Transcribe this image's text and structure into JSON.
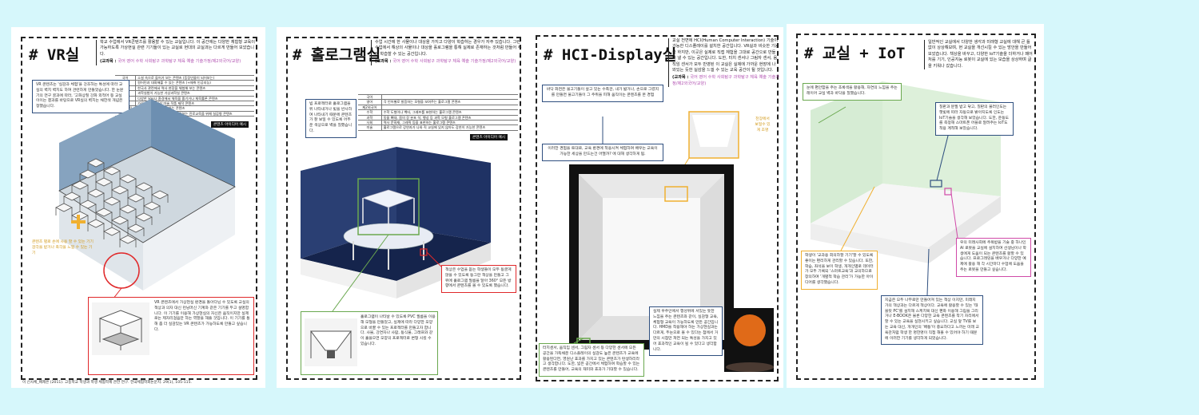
{
  "panels": {
    "vr": {
      "title": "# VR실",
      "intro": "학교 수업에서 VR콘텐츠를 활용할 수 있는 교실입니다. 이 공간에는 다양한 체험형 교육이 가능하도록 가상현실 관련 기기들이 있는 교실로 현대의 교실과는 다르게 만들어 보았습니다.",
      "subjects_label": "(교과목 :",
      "subjects_tags": "국어 영어 수학 사회탐구 과학탐구 체육 예술 기술가정/제2외국어/교양)",
      "table": [
        [
          "국어",
          "소설 속으로 들어가 보는 콘텐츠 (등장인물이 되어보는)"
        ],
        [
          "영어",
          "원어민과 대화해볼 수 있는 콘텐츠 (+매취 인공지능)"
        ],
        [
          "사회",
          "한국사 관련에서 역사 현장을 체험해 보는 콘텐츠"
        ],
        [
          "과학",
          "과학실험이 가능한 가상과학실 콘텐츠"
        ],
        [
          "체육",
          "다양한 날씨나 환경에서 체육을 즐기거나 체육률론 콘텐츠"
        ],
        [
          "예술",
          "가상 미술관, 가상 미술 작품 제작 콘텐츠"
        ],
        [
          "기술·가정",
          "요리 실습을 가상으로 하는 콘텐츠"
        ],
        [
          "진로·진로",
          "다양한 콘텐츠, 학교에서 어려워하는 진로교육을 위해 실감형 콘텐츠"
        ]
      ],
      "ex_button": "콘텐츠 아이디어 예시",
      "note_blue": "VR 콘텐츠는 '실감과 체험'을 강조하는 특성에 따라 교실의 벽치 벽치도 하여 관련하게 만들었습니다. 한 눈문기의 면구 골과에 따라, '고화상질 강화 외적어 등 교실이이는 결과를 바탕으로 VR실의 벽치는 채한색 개념은 정했습니다.",
      "note_orange": "콘텐츠 별로 손에 사용 할 수 있는 기기 감각을 받거나 촉각을 느낄 수 있는 기기",
      "note_red": "VR 콘텐츠에서 가상현실 환경을 돌아다님 수 있도록 교실의 책상과 의자 대신 런닝머신 기계와 같은 기기를 두고 설명합니다. 이 기기를 이용해 가상현실의 자신은 움직이지만 실제로는 제자리걸음만 하는 역할을 해줄 것입니다. 이 기기를 통해 좀 더 실감있는 VR 콘텐츠가 가능하도록 만들고 싶습니다.",
      "footer": "이 신사체_배제은 (2011). 고등학교 학생과 학생 체험학제 관한 연구. 한국체험학회논문지. 29(1), 105-115."
    },
    "holo": {
      "title": "# 홀로그램실",
      "intro": "수업 시간에 한 사물이나 대상을 가지고 다양이 학습하는 경우가 자주 있습니다. 그런 수업에서 해상의 사물이나 대상을 홀로그램을 통해 실제로 존재하는 것처럼 만들어 주어 학습할 수 있는 공간입니다.",
      "subjects_label": "(교과목 :",
      "subjects_tags": "국어 영어 수학 사회탐구 과학탐구 체육 예술 기술가정/제2외국어/교양)",
      "table": [
        [
          "국어",
          ""
        ],
        [
          "영어",
          "각 언어별로 발음하는 모형을 보여주는 홀로그램 콘텐츠"
        ],
        [
          "제2외국어",
          ""
        ],
        [
          "수학",
          "수학 도형이나 벡터, 그래프를 표현하는 홀로그램 콘텐츠"
        ],
        [
          "과학",
          "동물 뼈대, 몸의 장 분포 석, 행성 등 과학 모형 홀로그램 콘텐츠"
        ],
        [
          "사회",
          "역사 문화재, 그레픽 등을 표현하는 홀로그램 콘텐츠"
        ],
        [
          "미술",
          "홀로그램으로 강연자가 나와 직 교실에 있지 않아도 강연이 가능한 콘텐츠"
        ]
      ],
      "ex_button": "콘텐츠 아이디어 예시",
      "note_blue": "빔 프로젝터로 홀로그램을 위 나타내거나 빛을 반사하여 나타내기 때문에 콘텐츠가 잘 보일 수 있도록 어두운 색상으로 벽을 칠했습니다.",
      "note_red": "책상은 수업을 듣는 학생들이 모두 동글게 앉을 수 있도록 동그란 책상을 만들고 그 위에 홀로그램 필름을 달아 360° 모든 방향에서 콘텐츠를 볼 수 있도록 했습니다.",
      "note_green": "홀로그램이 나타날 수 있도록 PVC 필름을 이용해 모형을 만들었고, 실제에 따라 다양한 모양으로 바꿀 수 있는 프로젝터를 만들고자 합니다. 사물, 강연자나 사람, 동식물, 그래프와 같이 홀을으면 모양의 프로젝터로 변형 시킬 수 있습니다."
    },
    "hci": {
      "title": "# HCI-Display실",
      "intro": "교실 전면에 HCI(Human Computer Interaction) 기술이 가능한 디스플레이를 설치한 공간입니다. VR실과 비슷한 기능을 하지만, 이곳은 실제로 직접 체험을 그대로 공간으로 만들어 낼 수 있는 공간입니다. 도한, 터치 센서나 그림자 센서, 움직임 센서가 모두 반영된 이 교실은 실제에 가까운 현장에 나와있는 듯한 실감을 느낄 수 있는 교육 공간이 될 것입니다.",
      "subjects_label": "(교과목 :",
      "subjects_tags": "국어 영어 수학 사회탐구 과학탐구 체육 예술 기술가정/제2외국어/교양)",
      "note_blue1": "바닥 화면은 물고기들이 살고 있는 수족관, 내가 밟거나, 손으로 그렸지를 만들면 물고기들이 그 주위을 피해 움직이는 콘텐츠를 본 경험",
      "note_blue2": "이러한 경험을 토대로, 교육 환경에 적용시켜 체험하며 배우는 교육이 가능한 세상을 만드는건 어떨까? 에 대해 생각하게 됨.",
      "note_orange": "천장에서 보일수 있게 조명",
      "note_green": "터치센서, 움직임 센서, 그림자 센서 등 다양한 센서에 모든 공간을 가득채운 디스플레이의 실감도 높은 콘텐츠가 교육에 활용된다면, 영원난 효과를 가지고 있는 콘텐츠가 탄생하리라고 생각합니다. 도한, 넓은 공간에서 체험하며 학습할 수 있는 콘텐츠를 만들어, 교육의 재미와 효과가 기대할 수 있습니다.",
      "note_blue3": "실제 우주안에서 행성위에 서있는 듯한 느낌을 주는 콘텐츠와 같이, 실감형 교육, 체험형 교육이 가능하도록 만든 공간입니다. HMD을 착용해야 하는 가상현실과는 다르게, 두눈으로 볼 수 있다는 점에서 거만의 시점만 쳐면 되는 특성을 가지고 있어 효과적인 교육이 될 수 있다고 생각합니다."
    },
    "iot": {
      "title": "# 교실 + IoT",
      "intro": "일반적인 교실에서 다양한 생각과 미래형 교실에 대해 큰 틀없이 상상해보며, 현 교실을 개선시킬 수 있는 방안을 만들어 보았습니다. 책상을 바꾸고, 다양한 IoT기술을 더하거나 패어처를 기기, 인공지능 로봇이 교실에 있는 모습을 상상하며 글을 키워나 갔습니다.",
      "note_green": "눈에 편안함을 주는 초록색을 활용해, 자연의 느낌을 주는 레이어 교실 벽과 바닥을 칠했습니다.",
      "note_blue1": "칠판과 분필 받고 닦고, 칠판의 불러인도는 햇빛에 따라 자동으로 밝아지도록 인도는 IoT기술을 생각해 보았습니다. 도한, 운동도를 측정해 스마트폰 어플로 알려주는 IoT도 적용 계적해 보았습니다.",
      "note_pink": "우의 미래사회에 주목받을 기술 중 하나인 AI 로봇을 교실에 설치하여 선생님이나 학생에게 도움이 되는 콘텐츠를 활할 수 있습니다. 프로그래밍을 배우거나 다양한 예제에 활용 해 각 시간마다 수업에 도움을 주는 로봇을 만들고 싶습니다.",
      "note_orange": "학생이 '교과용 회의하할 기기'할 수 있도록 좋이는 편리하게 관리할 수 있습니다. 또한, 학습, 좌석을 보이 학생, 개개인별로 데이터가 모두 기록되 '스마트교육'과 교의하므로 창의하여 '개별적 학습 관리'가 가능한 아이디어를 생각했습니다.",
      "note_blue2": "지금은 모두 나무로만 만들어져 있는 책상 이지만, 미래지가의 책상과는 다르게 책상이다. 교육에 활용할 수 있는 '태블릿 PC'를 설치해 스케치북 대신 편화 이용해 그림을 그리거나 E-BOOK은 물론 다양한 교육 콘텐츠를 착기 자리에서 할 수 있는 교육을 실현시키고 싶습니다. 교실 앞 TV를 보는 교육 대신, 개개인의 '배틍'이 중요하다고 느끼는 미래 교육관처럼 학생 한 명한명이 직접 해볼 수 있어야 하기 때문에 이러한 기기를 생각하게 되었습니다."
    }
  },
  "colors": {
    "page_bg": "#d6f7fb",
    "blue_note": "#2f4f7f",
    "orange_note": "#f0b030",
    "red_note": "#e0282a",
    "green_note": "#6aa84f",
    "pink_note": "#d04aa8",
    "tag_purple": "#b04fb0"
  }
}
